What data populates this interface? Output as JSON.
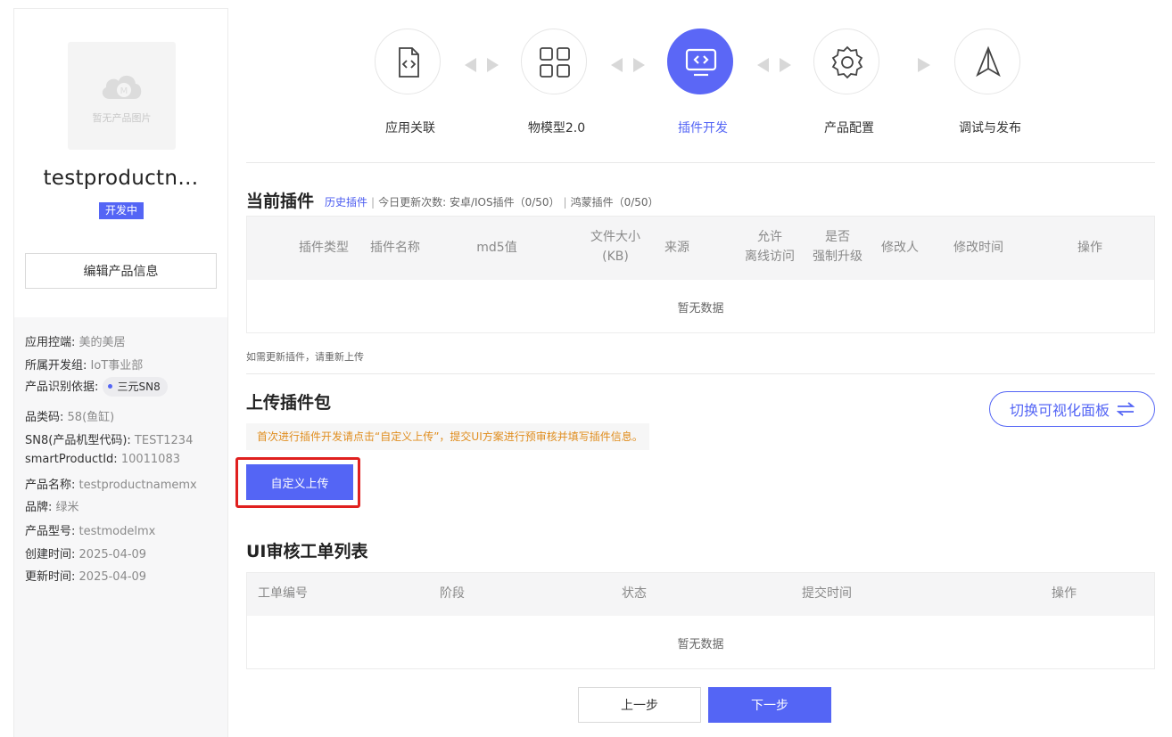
{
  "sidebar": {
    "no_image_text": "暂无产品图片",
    "product_name": "testproductn…",
    "status_badge": "开发中",
    "edit_button": "编辑产品信息",
    "info": {
      "app_control_label": "应用控端:",
      "app_control_value": "美的美居",
      "dev_group_label": "所属开发组:",
      "dev_group_value": "IoT事业部",
      "identify_label": "产品识别依据:",
      "identify_tag": "三元SN8",
      "category_label": "品类码:",
      "category_value": "58(鱼缸)",
      "sn8_label": "SN8(产品机型代码):",
      "sn8_value": "TEST1234",
      "smart_id_label": "smartProductId:",
      "smart_id_value": "10011083",
      "product_name_label": "产品名称:",
      "product_name_value": "testproductnamemx",
      "brand_label": "品牌:",
      "brand_value": "绿米",
      "model_label": "产品型号:",
      "model_value": "testmodelmx",
      "created_label": "创建时间:",
      "created_value": "2025-04-09",
      "updated_label": "更新时间:",
      "updated_value": "2025-04-09"
    }
  },
  "steps": [
    {
      "label": "应用关联",
      "icon": "code-file-icon"
    },
    {
      "label": "物模型2.0",
      "icon": "grid-icon"
    },
    {
      "label": "插件开发",
      "icon": "code-monitor-icon",
      "active": true
    },
    {
      "label": "产品配置",
      "icon": "gear-icon"
    },
    {
      "label": "调试与发布",
      "icon": "send-icon"
    }
  ],
  "plugin": {
    "title": "当前插件",
    "history_link": "历史插件",
    "today_updates": "今日更新次数:",
    "android_ios": "安卓/IOS插件（0/50）",
    "harmony": "鸿蒙插件（0/50）",
    "columns": {
      "type": "插件类型",
      "name": "插件名称",
      "md5": "md5值",
      "size_line1": "文件大小",
      "size_line2": "(KB)",
      "source": "来源",
      "offline_line1": "允许",
      "offline_line2": "离线访问",
      "force_line1": "是否",
      "force_line2": "强制升级",
      "modifier": "修改人",
      "modified_time": "修改时间",
      "action": "操作"
    },
    "empty_text": "暂无数据",
    "update_hint": "如需更新插件，请重新上传"
  },
  "upload": {
    "title": "上传插件包",
    "tip": "首次进行插件开发请点击“自定义上传”，提交UI方案进行预审核并填写插件信息。",
    "custom_upload_button": "自定义上传",
    "switch_button": "切换可视化面板"
  },
  "review": {
    "title": "UI审核工单列表",
    "columns": {
      "order_no": "工单编号",
      "stage": "阶段",
      "status": "状态",
      "submit_time": "提交时间",
      "action": "操作"
    },
    "empty_text": "暂无数据"
  },
  "footer": {
    "prev_button": "上一步",
    "next_button": "下一步"
  },
  "colors": {
    "accent": "#5465f5",
    "warning_text": "#e08d1e",
    "highlight_border": "#e0201f"
  }
}
